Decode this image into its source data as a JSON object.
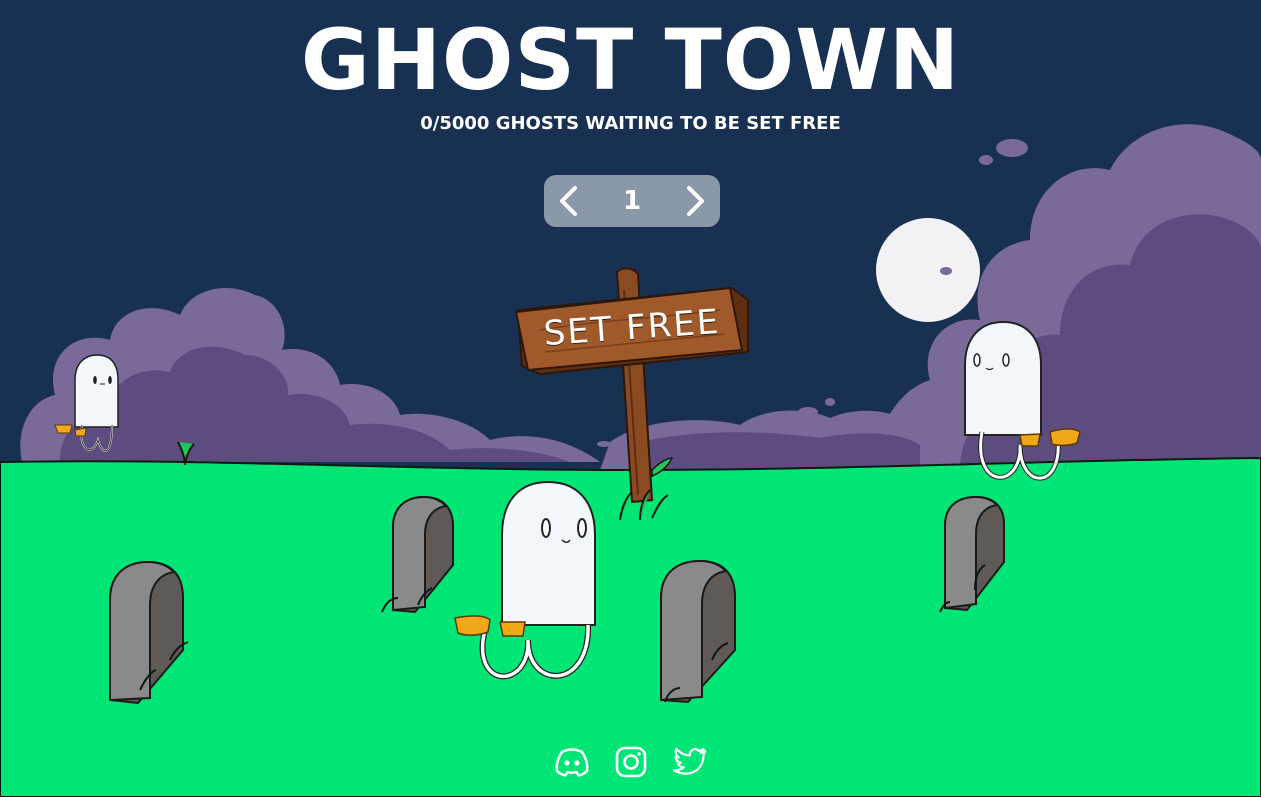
{
  "header": {
    "title": "GHOST TOWN",
    "subtitle": "0/5000 GHOSTS WAITING TO BE SET FREE"
  },
  "pager": {
    "value": "1",
    "prev_icon": "chevron-left-icon",
    "next_icon": "chevron-right-icon"
  },
  "sign": {
    "label": "SET FREE"
  },
  "footer": {
    "social": [
      {
        "icon": "discord-icon"
      },
      {
        "icon": "instagram-icon"
      },
      {
        "icon": "twitter-icon"
      }
    ]
  },
  "colors": {
    "sky": "#183152",
    "grass": "#00e676",
    "cloud": "#7a6a9a",
    "cloud_shadow": "#5c4d7e",
    "moon": "#f2f2f5",
    "tombstone": "#8a8a8a",
    "tombstone_shadow": "#5f5a55",
    "wood": "#8a4a22",
    "pager_bg": "#8b98aa",
    "text": "#ffffff"
  }
}
